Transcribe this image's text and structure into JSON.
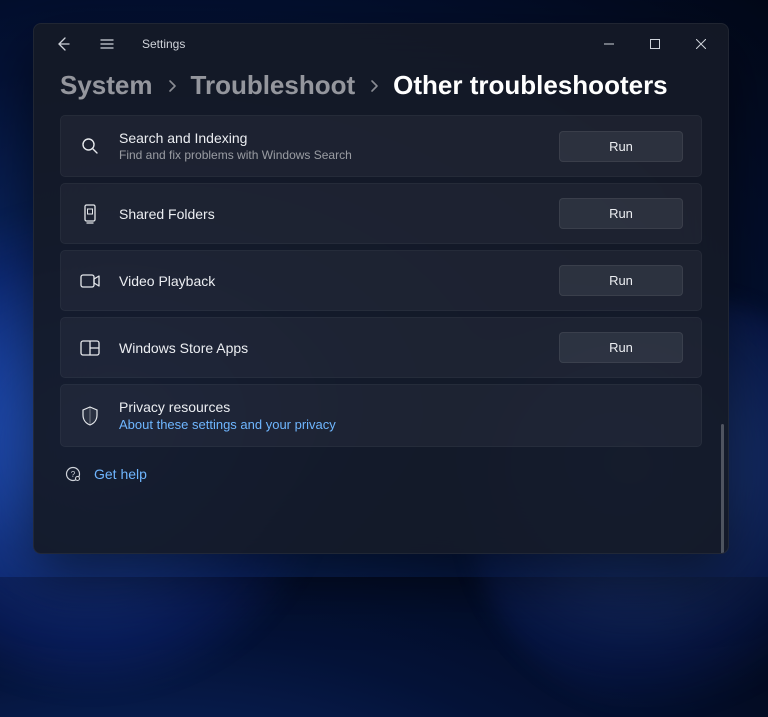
{
  "appTitle": "Settings",
  "breadcrumb": {
    "items": [
      "System",
      "Troubleshoot",
      "Other troubleshooters"
    ]
  },
  "troubleshooters": [
    {
      "id": "search-indexing",
      "title": "Search and Indexing",
      "desc": "Find and fix problems with Windows Search",
      "run": "Run"
    },
    {
      "id": "shared-folders",
      "title": "Shared Folders",
      "desc": "",
      "run": "Run"
    },
    {
      "id": "video-playback",
      "title": "Video Playback",
      "desc": "",
      "run": "Run"
    },
    {
      "id": "windows-store-apps",
      "title": "Windows Store Apps",
      "desc": "",
      "run": "Run"
    }
  ],
  "privacy": {
    "title": "Privacy resources",
    "link": "About these settings and your privacy"
  },
  "help": {
    "label": "Get help"
  }
}
